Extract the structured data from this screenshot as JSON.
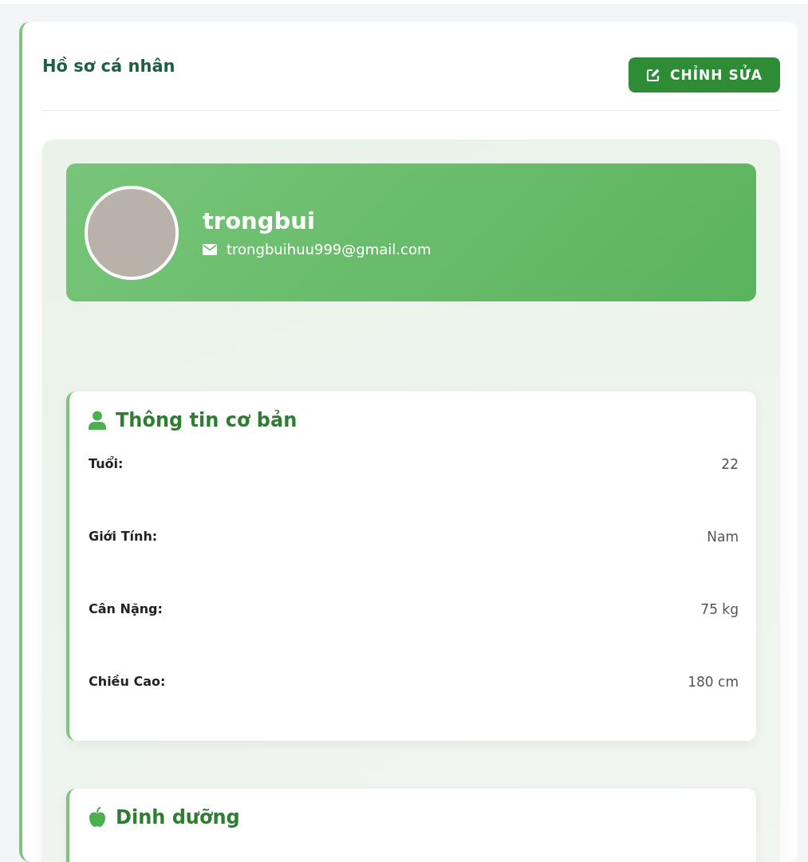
{
  "header": {
    "title": "Hồ sơ cá nhân",
    "edit_button": "CHỈNH SỬA"
  },
  "profile": {
    "username": "trongbui",
    "email": "trongbuihuu999@gmail.com"
  },
  "sections": [
    {
      "kind": "person",
      "title": "Thông tin cơ bản",
      "rows": [
        {
          "label": "Tuổi:",
          "value": "22"
        },
        {
          "label": "Giới Tính:",
          "value": "Nam"
        },
        {
          "label": "Cân Nặng:",
          "value": "75 kg"
        },
        {
          "label": "Chiều Cao:",
          "value": "180 cm"
        }
      ]
    },
    {
      "kind": "nutrition",
      "title": "Dinh dưỡng"
    }
  ]
}
